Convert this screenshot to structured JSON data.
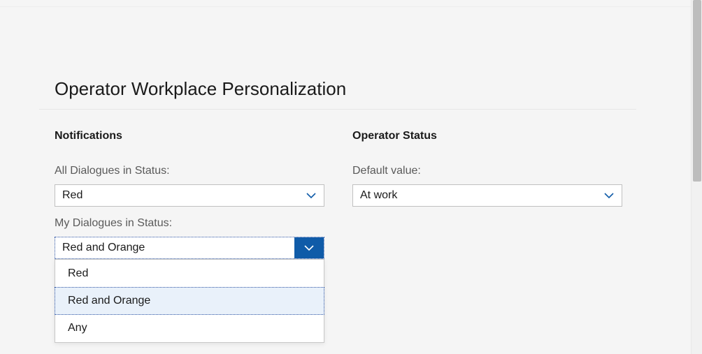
{
  "page": {
    "title": "Operator Workplace Personalization"
  },
  "notifications": {
    "heading": "Notifications",
    "all_dialogues_label": "All Dialogues in Status:",
    "all_dialogues_value": "Red",
    "my_dialogues_label": "My Dialogues in Status:",
    "my_dialogues_value": "Red and Orange",
    "my_dialogues_options": [
      "Red",
      "Red and Orange",
      "Any"
    ]
  },
  "operator_status": {
    "heading": "Operator Status",
    "default_value_label": "Default value:",
    "default_value": "At work"
  },
  "colors": {
    "accent": "#0f5ba8",
    "option_highlight": "#e9f1fa"
  }
}
